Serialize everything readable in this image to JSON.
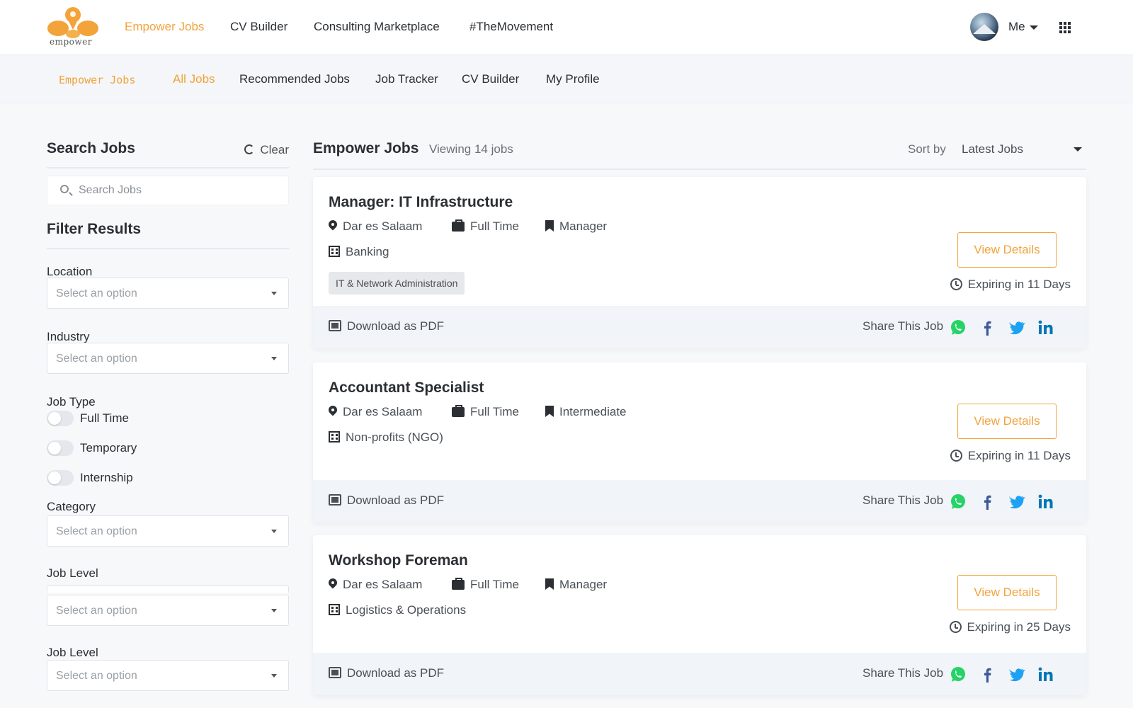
{
  "topnav": {
    "logo_text": "empower",
    "links": [
      "Empower Jobs",
      "CV Builder",
      "Consulting Marketplace",
      "#TheMovement"
    ],
    "user_label": "Me"
  },
  "subnav": {
    "brand": "Empower Jobs",
    "links": [
      "All Jobs",
      "Recommended Jobs",
      "Job Tracker",
      "CV Builder",
      "My Profile"
    ]
  },
  "sidebar": {
    "title": "Search Jobs",
    "clear_label": "Clear",
    "search_placeholder": "Search Jobs",
    "filter_title": "Filter Results",
    "location_label": "Location",
    "industry_label": "Industry",
    "job_type_label": "Job Type",
    "job_types": [
      "Full Time",
      "Temporary",
      "Internship"
    ],
    "category_label": "Category",
    "job_level_label": "Job Level",
    "job_level_label_2": "Job Level",
    "select_placeholder": "Select an option"
  },
  "main": {
    "title": "Empower Jobs",
    "count": "Viewing 14 jobs",
    "sort_label": "Sort by",
    "sort_value": "Latest Jobs"
  },
  "jobs": [
    {
      "title": "Manager: IT Infrastructure",
      "location": "Dar es Salaam",
      "type": "Full Time",
      "level": "Manager",
      "industry": "Banking",
      "tag": "IT & Network Administration",
      "expiry": "Expiring in 11 Days"
    },
    {
      "title": "Accountant Specialist",
      "location": "Dar es Salaam",
      "type": "Full Time",
      "level": "Intermediate",
      "industry": "Non-profits (NGO)",
      "expiry": "Expiring in 11 Days"
    },
    {
      "title": "Workshop Foreman",
      "location": "Dar es Salaam",
      "type": "Full Time",
      "level": "Manager",
      "industry": "Logistics & Operations",
      "expiry": "Expiring in 25 Days"
    }
  ],
  "card_actions": {
    "view_details": "View Details",
    "download_pdf": "Download as PDF",
    "share_label": "Share This Job"
  },
  "colors": {
    "accent": "#f2a33a",
    "whatsapp": "#25d366",
    "facebook": "#3b5998",
    "twitter": "#1da1f2",
    "linkedin": "#0077b5"
  }
}
